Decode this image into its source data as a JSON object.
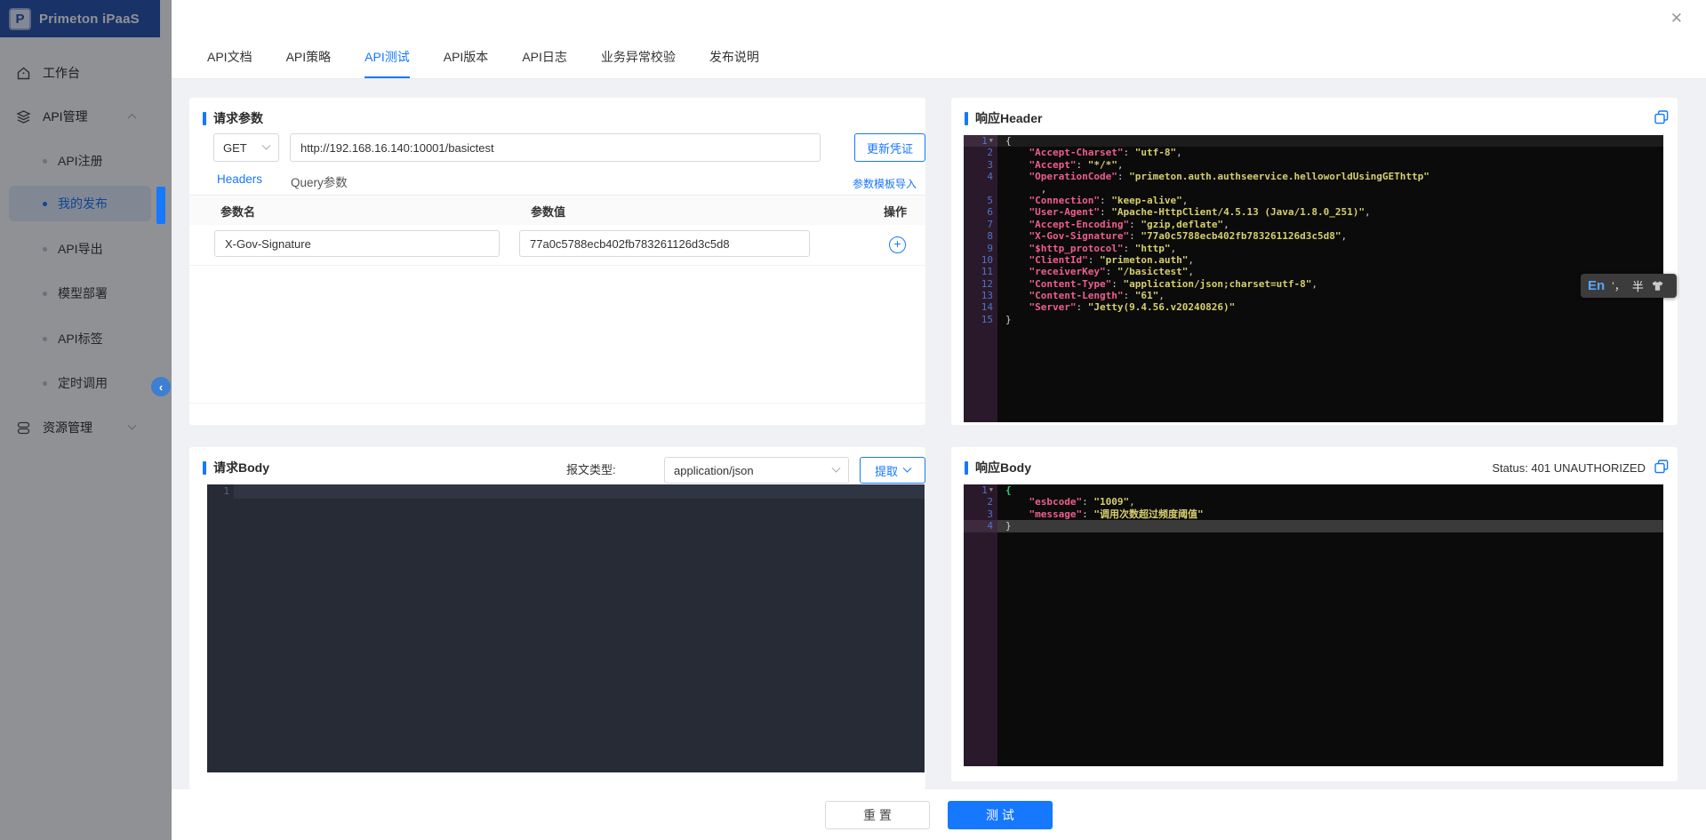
{
  "app": {
    "title": "Primeton iPaaS",
    "logo_letter": "P"
  },
  "icons": {
    "close": "✕",
    "collapse": "‹",
    "plus": "+"
  },
  "sidebar": {
    "items": [
      {
        "label": "工作台"
      },
      {
        "label": "API管理"
      },
      {
        "label": "API注册"
      },
      {
        "label": "我的发布"
      },
      {
        "label": "API导出"
      },
      {
        "label": "模型部署"
      },
      {
        "label": "API标签"
      },
      {
        "label": "定时调用"
      },
      {
        "label": "资源管理"
      }
    ]
  },
  "modal": {
    "tabs": [
      "API文档",
      "API策略",
      "API测试",
      "API版本",
      "API日志",
      "业务异常校验",
      "发布说明"
    ],
    "active_tab": "API测试"
  },
  "request_params": {
    "title": "请求参数",
    "method": "GET",
    "url": "http://192.168.16.140:10001/basictest",
    "update_credential": "更新凭证",
    "subtabs": [
      "Headers",
      "Query参数"
    ],
    "template_import": "参数模板导入",
    "columns": [
      "参数名",
      "参数值",
      "操作"
    ],
    "rows": [
      {
        "name": "X-Gov-Signature",
        "value": "77a0c5788ecb402fb783261126d3c5d8"
      }
    ]
  },
  "request_body": {
    "title": "请求Body",
    "type_label": "报文类型:",
    "type_value": "application/json",
    "extract": "提取",
    "code": {
      "lines": [
        {
          "n": "1",
          "a": 3,
          "t": []
        }
      ]
    }
  },
  "response_header": {
    "title": "响应Header",
    "code": {
      "lines": [
        {
          "n": "1",
          "f": 1,
          "a": 1,
          "t": [
            [
              "w",
              "{"
            ]
          ]
        },
        {
          "n": "2",
          "t": [
            [
              "w",
              "    "
            ],
            [
              "k",
              "\"Accept-Charset\""
            ],
            [
              "w",
              ": "
            ],
            [
              "v",
              "\"utf-8\""
            ],
            [
              "w",
              ","
            ]
          ]
        },
        {
          "n": "3",
          "t": [
            [
              "w",
              "    "
            ],
            [
              "k",
              "\"Accept\""
            ],
            [
              "w",
              ": "
            ],
            [
              "v",
              "\"*/*\""
            ],
            [
              "w",
              ","
            ]
          ]
        },
        {
          "n": "4",
          "t": [
            [
              "w",
              "    "
            ],
            [
              "k",
              "\"OperationCode\""
            ],
            [
              "w",
              ": "
            ],
            [
              "v",
              "\"primeton.auth.authseervice.helloworldUsingGEThttp\""
            ]
          ]
        },
        {
          "n": "",
          "t": [
            [
              "w",
              "      ,"
            ]
          ]
        },
        {
          "n": "5",
          "t": [
            [
              "w",
              "    "
            ],
            [
              "k",
              "\"Connection\""
            ],
            [
              "w",
              ": "
            ],
            [
              "v",
              "\"keep-alive\""
            ],
            [
              "w",
              ","
            ]
          ]
        },
        {
          "n": "6",
          "t": [
            [
              "w",
              "    "
            ],
            [
              "k",
              "\"User-Agent\""
            ],
            [
              "w",
              ": "
            ],
            [
              "v",
              "\"Apache-HttpClient/4.5.13 (Java/1.8.0_251)\""
            ],
            [
              "w",
              ","
            ]
          ]
        },
        {
          "n": "7",
          "t": [
            [
              "w",
              "    "
            ],
            [
              "k",
              "\"Accept-Encoding\""
            ],
            [
              "w",
              ": "
            ],
            [
              "v",
              "\"gzip,deflate\""
            ],
            [
              "w",
              ","
            ]
          ]
        },
        {
          "n": "8",
          "t": [
            [
              "w",
              "    "
            ],
            [
              "k",
              "\"X-Gov-Signature\""
            ],
            [
              "w",
              ": "
            ],
            [
              "v",
              "\"77a0c5788ecb402fb783261126d3c5d8\""
            ],
            [
              "w",
              ","
            ]
          ]
        },
        {
          "n": "9",
          "t": [
            [
              "w",
              "    "
            ],
            [
              "k",
              "\"$http_protocol\""
            ],
            [
              "w",
              ": "
            ],
            [
              "v",
              "\"http\""
            ],
            [
              "w",
              ","
            ]
          ]
        },
        {
          "n": "10",
          "t": [
            [
              "w",
              "    "
            ],
            [
              "k",
              "\"ClientId\""
            ],
            [
              "w",
              ": "
            ],
            [
              "v",
              "\"primeton.auth\""
            ],
            [
              "w",
              ","
            ]
          ]
        },
        {
          "n": "11",
          "t": [
            [
              "w",
              "    "
            ],
            [
              "k",
              "\"receiverKey\""
            ],
            [
              "w",
              ": "
            ],
            [
              "v",
              "\"/basictest\""
            ],
            [
              "w",
              ","
            ]
          ]
        },
        {
          "n": "12",
          "t": [
            [
              "w",
              "    "
            ],
            [
              "k",
              "\"Content-Type\""
            ],
            [
              "w",
              ": "
            ],
            [
              "v",
              "\"application/json;charset=utf-8\""
            ],
            [
              "w",
              ","
            ]
          ]
        },
        {
          "n": "13",
          "t": [
            [
              "w",
              "    "
            ],
            [
              "k",
              "\"Content-Length\""
            ],
            [
              "w",
              ": "
            ],
            [
              "v",
              "\"61\""
            ],
            [
              "w",
              ","
            ]
          ]
        },
        {
          "n": "14",
          "t": [
            [
              "w",
              "    "
            ],
            [
              "k",
              "\"Server\""
            ],
            [
              "w",
              ": "
            ],
            [
              "v",
              "\"Jetty(9.4.56.v20240826)\""
            ]
          ]
        },
        {
          "n": "15",
          "t": [
            [
              "w",
              "}"
            ]
          ]
        }
      ]
    }
  },
  "response_body": {
    "title": "响应Body",
    "status": "Status: 401 UNAUTHORIZED",
    "code": {
      "lines": [
        {
          "n": "1",
          "f": 1,
          "t": [
            [
              "gr",
              "{"
            ]
          ]
        },
        {
          "n": "2",
          "t": [
            [
              "w",
              "    "
            ],
            [
              "k",
              "\"esbcode\""
            ],
            [
              "w",
              ": "
            ],
            [
              "v",
              "\"1009\""
            ],
            [
              "w",
              ","
            ]
          ]
        },
        {
          "n": "3",
          "t": [
            [
              "w",
              "    "
            ],
            [
              "k",
              "\"message\""
            ],
            [
              "w",
              ": "
            ],
            [
              "v",
              "\"调用次数超过频度阈值\""
            ]
          ]
        },
        {
          "n": "4",
          "a": 2,
          "t": [
            [
              "w",
              "}"
            ]
          ]
        }
      ]
    }
  },
  "footer": {
    "reset": "重 置",
    "test": "测 试"
  },
  "ime": {
    "lang": "En",
    "punct": "’，",
    "width": "半"
  },
  "colors": {
    "accent": "#1677ff",
    "editor_bg": "#0b0b0b",
    "gutter_bg": "#2a192b"
  }
}
